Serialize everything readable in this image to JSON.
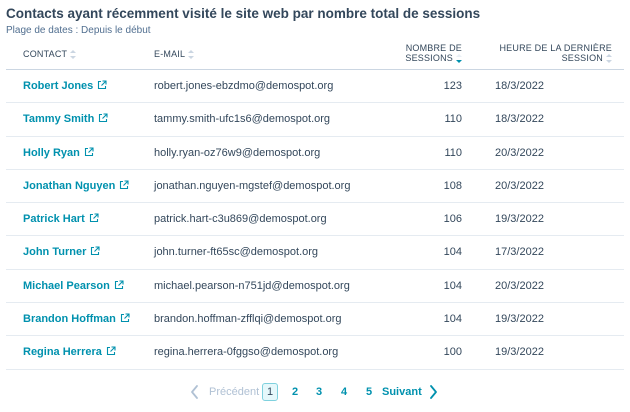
{
  "report": {
    "title": "Contacts ayant récemment visité le site web par nombre total de sessions",
    "date_range": "Plage de dates : Depuis le début"
  },
  "columns": {
    "contact": "CONTACT",
    "email": "E-MAIL",
    "sessions_line1": "NOMBRE DE",
    "sessions_line2": "SESSIONS",
    "date_line1": "HEURE DE LA DERNIÈRE",
    "date_line2": "SESSION"
  },
  "sort": {
    "column": "sessions",
    "direction": "descending"
  },
  "rows": [
    {
      "name": "Robert Jones",
      "email": "robert.jones-ebzdmo@demospot.org",
      "sessions": "123",
      "last_session": "18/3/2022"
    },
    {
      "name": "Tammy Smith",
      "email": "tammy.smith-ufc1s6@demospot.org",
      "sessions": "110",
      "last_session": "18/3/2022"
    },
    {
      "name": "Holly Ryan",
      "email": "holly.ryan-oz76w9@demospot.org",
      "sessions": "110",
      "last_session": "20/3/2022"
    },
    {
      "name": "Jonathan Nguyen",
      "email": "jonathan.nguyen-mgstef@demospot.org",
      "sessions": "108",
      "last_session": "20/3/2022"
    },
    {
      "name": "Patrick Hart",
      "email": "patrick.hart-c3u869@demospot.org",
      "sessions": "106",
      "last_session": "19/3/2022"
    },
    {
      "name": "John Turner",
      "email": "john.turner-ft65sc@demospot.org",
      "sessions": "104",
      "last_session": "17/3/2022"
    },
    {
      "name": "Michael Pearson",
      "email": "michael.pearson-n751jd@demospot.org",
      "sessions": "104",
      "last_session": "20/3/2022"
    },
    {
      "name": "Brandon Hoffman",
      "email": "brandon.hoffman-zfflqi@demospot.org",
      "sessions": "104",
      "last_session": "19/3/2022"
    },
    {
      "name": "Regina Herrera",
      "email": "regina.herrera-0fggso@demospot.org",
      "sessions": "100",
      "last_session": "19/3/2022"
    }
  ],
  "pagination": {
    "previous": "Précédent",
    "next": "Suivant",
    "pages": [
      "1",
      "2",
      "3",
      "4",
      "5"
    ],
    "current": "1"
  },
  "icons": {
    "external_link": "external-link-icon",
    "previous": "chevron-left-icon",
    "next": "chevron-right-icon"
  },
  "colors": {
    "link": "#0091ae",
    "text": "#33475b",
    "divider": "#e5ebf1",
    "disabled": "#b0c1d4"
  }
}
